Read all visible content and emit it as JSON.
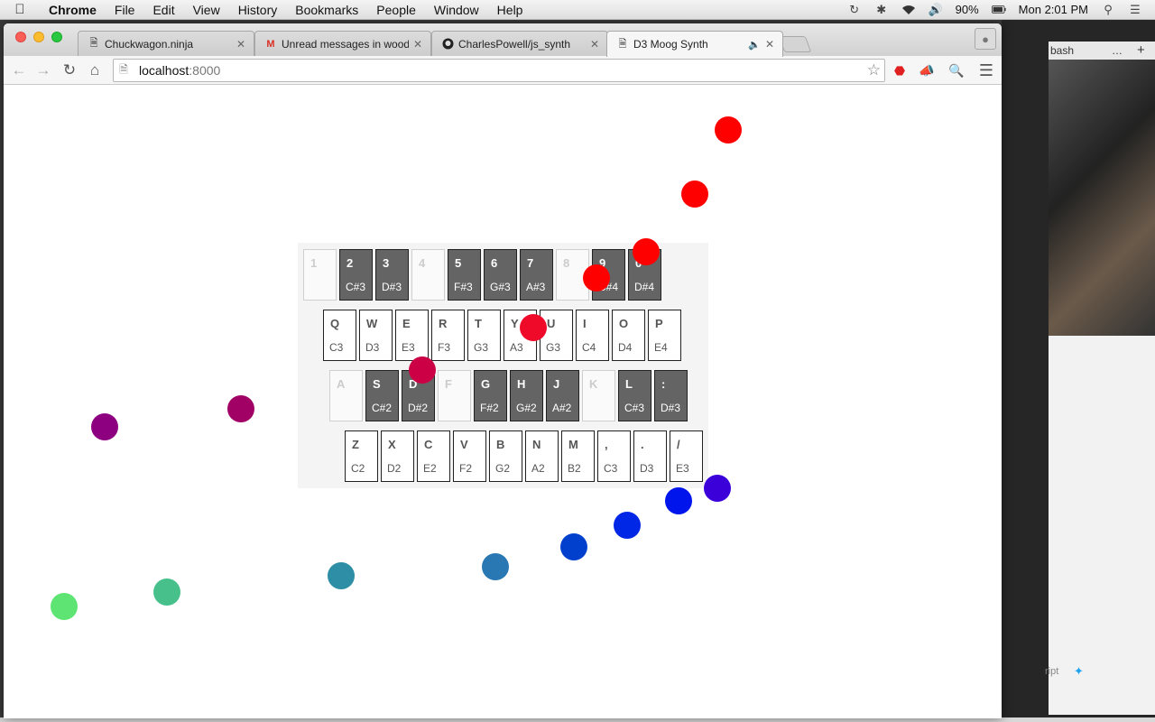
{
  "menubar": {
    "app_name": "Chrome",
    "items": [
      "File",
      "Edit",
      "View",
      "History",
      "Bookmarks",
      "People",
      "Window",
      "Help"
    ],
    "battery": "90%",
    "clock": "Mon 2:01 PM"
  },
  "background_window": {
    "tab_fragment": "bash",
    "text_fragment": "ript"
  },
  "tabs": [
    {
      "title": "Chuckwagon.ninja",
      "icon": "page-icon"
    },
    {
      "title": "Unread messages in wood",
      "icon": "gmail-icon"
    },
    {
      "title": "CharlesPowell/js_synth",
      "icon": "github-icon"
    },
    {
      "title": "D3 Moog Synth",
      "icon": "page-icon",
      "active": true,
      "audio": true
    }
  ],
  "omnibox": {
    "host": "localhost",
    "port": ":8000"
  },
  "keyboard": {
    "rows": [
      [
        {
          "letter": "1",
          "note": "",
          "kind": "blank"
        },
        {
          "letter": "2",
          "note": "C#3",
          "kind": "black"
        },
        {
          "letter": "3",
          "note": "D#3",
          "kind": "black"
        },
        {
          "letter": "4",
          "note": "",
          "kind": "blank"
        },
        {
          "letter": "5",
          "note": "F#3",
          "kind": "black"
        },
        {
          "letter": "6",
          "note": "G#3",
          "kind": "black"
        },
        {
          "letter": "7",
          "note": "A#3",
          "kind": "black"
        },
        {
          "letter": "8",
          "note": "",
          "kind": "blank"
        },
        {
          "letter": "9",
          "note": "C#4",
          "kind": "black"
        },
        {
          "letter": "0",
          "note": "D#4",
          "kind": "black"
        }
      ],
      [
        {
          "letter": "Q",
          "note": "C3",
          "kind": "white"
        },
        {
          "letter": "W",
          "note": "D3",
          "kind": "white"
        },
        {
          "letter": "E",
          "note": "E3",
          "kind": "white"
        },
        {
          "letter": "R",
          "note": "F3",
          "kind": "white"
        },
        {
          "letter": "T",
          "note": "G3",
          "kind": "white"
        },
        {
          "letter": "Y",
          "note": "A3",
          "kind": "white"
        },
        {
          "letter": "U",
          "note": "G3",
          "kind": "white"
        },
        {
          "letter": "I",
          "note": "C4",
          "kind": "white"
        },
        {
          "letter": "O",
          "note": "D4",
          "kind": "white"
        },
        {
          "letter": "P",
          "note": "E4",
          "kind": "white"
        }
      ],
      [
        {
          "letter": "A",
          "note": "",
          "kind": "blank"
        },
        {
          "letter": "S",
          "note": "C#2",
          "kind": "black"
        },
        {
          "letter": "D",
          "note": "D#2",
          "kind": "black"
        },
        {
          "letter": "F",
          "note": "",
          "kind": "blank"
        },
        {
          "letter": "G",
          "note": "F#2",
          "kind": "black"
        },
        {
          "letter": "H",
          "note": "G#2",
          "kind": "black"
        },
        {
          "letter": "J",
          "note": "A#2",
          "kind": "black"
        },
        {
          "letter": "K",
          "note": "",
          "kind": "blank"
        },
        {
          "letter": "L",
          "note": "C#3",
          "kind": "black"
        },
        {
          "letter": ":",
          "note": "D#3",
          "kind": "black"
        }
      ],
      [
        {
          "letter": "Z",
          "note": "C2",
          "kind": "white"
        },
        {
          "letter": "X",
          "note": "D2",
          "kind": "white"
        },
        {
          "letter": "C",
          "note": "E2",
          "kind": "white"
        },
        {
          "letter": "V",
          "note": "F2",
          "kind": "white"
        },
        {
          "letter": "B",
          "note": "G2",
          "kind": "white"
        },
        {
          "letter": "N",
          "note": "A2",
          "kind": "white"
        },
        {
          "letter": "M",
          "note": "B2",
          "kind": "white"
        },
        {
          "letter": ",",
          "note": "C3",
          "kind": "white"
        },
        {
          "letter": ".",
          "note": "D3",
          "kind": "white"
        },
        {
          "letter": "/",
          "note": "E3",
          "kind": "white"
        }
      ]
    ]
  },
  "dot_colors": [
    "#ff0000",
    "#ff0000",
    "#ff0000",
    "#ff0000",
    "#f00a2a",
    "#cc0044",
    "#a10065",
    "#8d0080",
    "#3b00d9",
    "#0015ec",
    "#0027e6",
    "#0040cc",
    "#2978b3",
    "#2e8ea6",
    "#48c08c",
    "#5ee472"
  ]
}
